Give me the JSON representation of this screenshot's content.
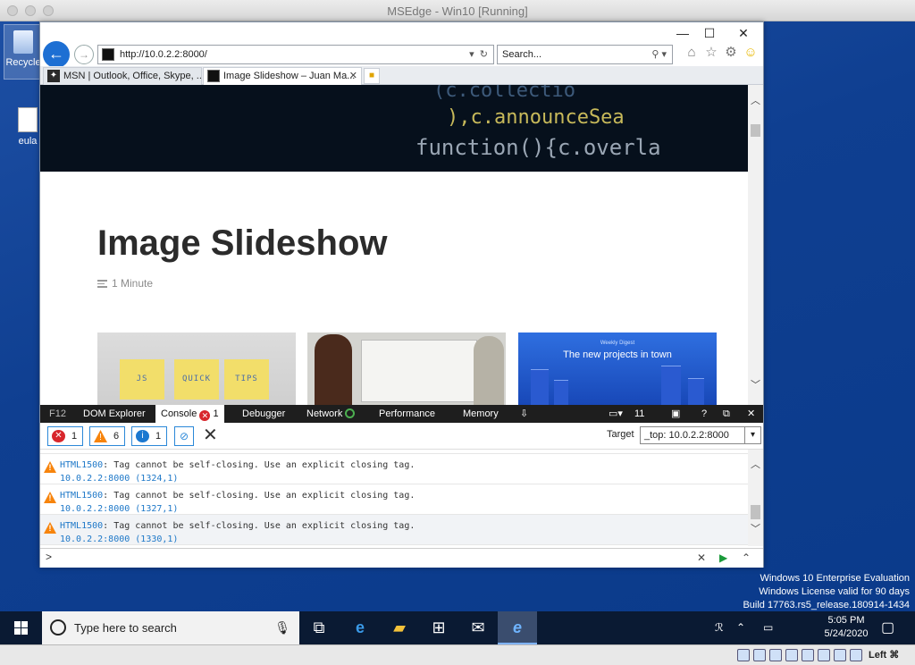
{
  "host": {
    "window_title": "MSEdge - Win10 [Running]",
    "status_label": "Left ⌘"
  },
  "desktop": {
    "icons": [
      {
        "label": "Recycle"
      },
      {
        "label": "eula"
      }
    ],
    "watermark": {
      "line1": "Windows 10 Enterprise Evaluation",
      "line2": "Windows License valid for 90 days",
      "line3": "Build 17763.rs5_release.180914-1434"
    }
  },
  "browser": {
    "address": "http://10.0.2.2:8000/",
    "search_placeholder": "Search...",
    "tabs": [
      {
        "label": "MSN | Outlook, Office, Skype, ...",
        "active": false
      },
      {
        "label": "Image Slideshow – Juan Ma...",
        "active": true
      }
    ]
  },
  "page": {
    "hero_code": {
      "line1": "(c.collectio",
      "line2": "),c.announceSea",
      "line3": "function(){c.overla"
    },
    "title": "Image Slideshow",
    "read_time": "1 Minute",
    "thumbs": {
      "notes": [
        "JS",
        "QUICK",
        "TIPS"
      ],
      "promo_small": "Weekly Digest",
      "promo_big": "The new projects in town"
    }
  },
  "devtools": {
    "tabs": [
      "F12",
      "DOM Explorer",
      "Console",
      "Debugger",
      "Network",
      "Performance",
      "Memory"
    ],
    "console_error_badge": "1",
    "emulation_count": "11",
    "filters": {
      "errors": "1",
      "warnings": "6",
      "info": "1"
    },
    "target_label": "Target",
    "target_value": "_top: 10.0.2.2:8000",
    "messages": [
      {
        "code": "HTML1500",
        "text": ": Tag cannot be self-closing. Use an explicit closing tag.",
        "source": "10.0.2.2:8000 (1324,1)"
      },
      {
        "code": "HTML1500",
        "text": ": Tag cannot be self-closing. Use an explicit closing tag.",
        "source": "10.0.2.2:8000 (1327,1)"
      },
      {
        "code": "HTML1500",
        "text": ": Tag cannot be self-closing. Use an explicit closing tag.",
        "source": "10.0.2.2:8000 (1330,1)"
      }
    ]
  },
  "taskbar": {
    "search_placeholder": "Type here to search",
    "time": "5:05 PM",
    "date": "5/24/2020"
  }
}
